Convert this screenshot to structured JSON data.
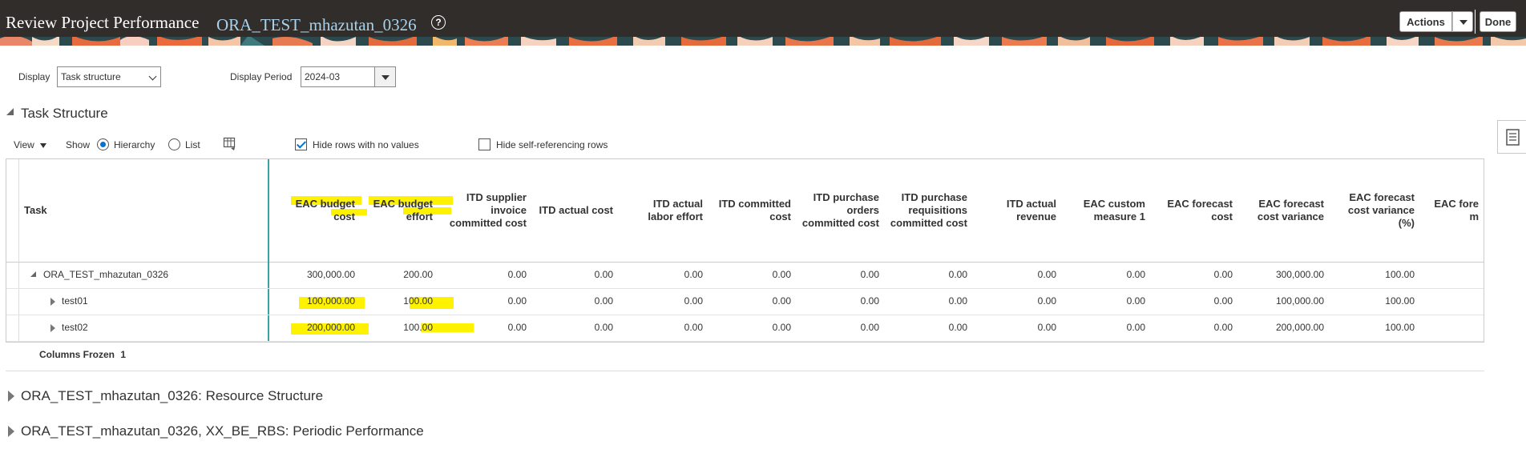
{
  "header": {
    "title": "Review Project Performance",
    "project_name": "ORA_TEST_mhazutan_0326",
    "actions_label": "Actions",
    "done_label": "Done"
  },
  "filters": {
    "display_label": "Display",
    "display_value": "Task structure",
    "period_label": "Display Period",
    "period_value": "2024-03"
  },
  "task_section": {
    "title": "Task Structure",
    "view_label": "View",
    "show_label": "Show",
    "hierarchy_label": "Hierarchy",
    "list_label": "List",
    "hierarchy_selected": true,
    "hide_no_values_label": "Hide rows with no values",
    "hide_no_values_checked": true,
    "hide_self_ref_label": "Hide self-referencing rows",
    "hide_self_ref_checked": false,
    "columns_frozen_label": "Columns Frozen",
    "columns_frozen_value": "1"
  },
  "table": {
    "task_header": "Task",
    "columns": [
      [
        "EAC budget",
        "cost"
      ],
      [
        "EAC budget",
        "effort"
      ],
      [
        "ITD supplier",
        "invoice",
        "committed cost"
      ],
      [
        "ITD actual cost"
      ],
      [
        "ITD actual",
        "labor effort"
      ],
      [
        "ITD committed",
        "cost"
      ],
      [
        "ITD purchase",
        "orders",
        "committed cost"
      ],
      [
        "ITD purchase",
        "requisitions",
        "committed cost"
      ],
      [
        "ITD actual",
        "revenue"
      ],
      [
        "EAC custom",
        "measure 1"
      ],
      [
        "EAC forecast",
        "cost"
      ],
      [
        "EAC forecast",
        "cost variance"
      ],
      [
        "EAC forecast",
        "cost variance",
        "(%)"
      ],
      [
        "EAC fore",
        "m"
      ]
    ],
    "rows": [
      {
        "task": "ORA_TEST_mhazutan_0326",
        "level": 0,
        "expanded": true,
        "values": [
          "300,000.00",
          "200.00",
          "0.00",
          "0.00",
          "0.00",
          "0.00",
          "0.00",
          "0.00",
          "0.00",
          "0.00",
          "0.00",
          "300,000.00",
          "100.00"
        ]
      },
      {
        "task": "test01",
        "level": 1,
        "expanded": false,
        "values": [
          "100,000.00",
          "100.00",
          "0.00",
          "0.00",
          "0.00",
          "0.00",
          "0.00",
          "0.00",
          "0.00",
          "0.00",
          "0.00",
          "100,000.00",
          "100.00"
        ]
      },
      {
        "task": "test02",
        "level": 1,
        "expanded": false,
        "values": [
          "200,000.00",
          "100.00",
          "0.00",
          "0.00",
          "0.00",
          "0.00",
          "0.00",
          "0.00",
          "0.00",
          "0.00",
          "0.00",
          "200,000.00",
          "100.00"
        ]
      }
    ]
  },
  "collapsed_sections": [
    {
      "title": "ORA_TEST_mhazutan_0326: Resource Structure"
    },
    {
      "title": "ORA_TEST_mhazutan_0326, XX_BE_RBS: Periodic Performance"
    }
  ],
  "colors": {
    "header_bg": "#312d2a",
    "project_link": "#a9d2ec",
    "accent_blue": "#0572ce",
    "frozen_divider": "#3aa3a6",
    "highlight": "#fff200"
  }
}
